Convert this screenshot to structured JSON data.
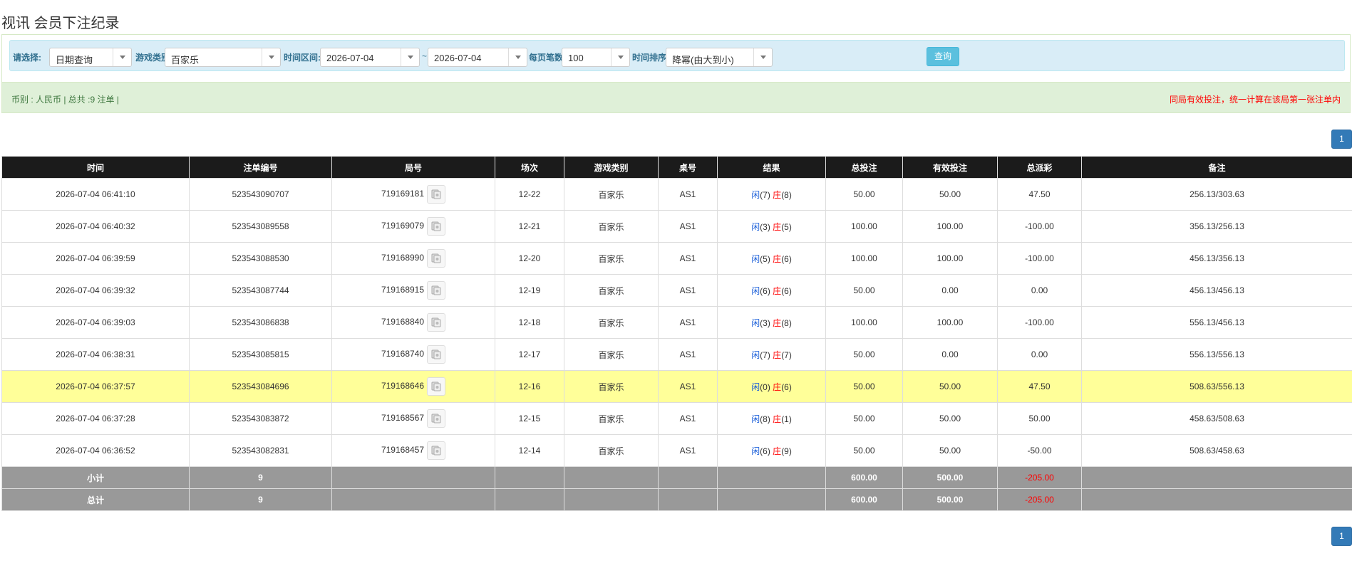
{
  "page": {
    "title": "视讯 会员下注纪录"
  },
  "filters": {
    "select_label": "请选择:",
    "select_value": "日期查询",
    "game_type_label": "游戏类别",
    "game_type_value": "百家乐",
    "time_range_label": "时间区间:",
    "date_from": "2026-07-04",
    "tilde": "~",
    "date_to": "2026-07-04",
    "page_size_label": "每页笔数:",
    "page_size_value": "100",
    "sort_label": "时间排序:",
    "sort_value": "降幂(由大到小)",
    "query_button": "查询"
  },
  "summary": {
    "left": "币别 : 人民币 | 总共 :9 注单 |",
    "right": "同局有效投注，统一计算在该局第一张注单内"
  },
  "pagination": {
    "current_page": "1"
  },
  "table": {
    "columns": [
      "时间",
      "注单编号",
      "局号",
      "场次",
      "游戏类别",
      "桌号",
      "结果",
      "总投注",
      "有效投注",
      "总派彩",
      "备注"
    ],
    "rows": [
      {
        "time": "2026-07-04 06:41:10",
        "bet_id": "523543090707",
        "round": "719169181",
        "shoe": "12-22",
        "game": "百家乐",
        "table": "AS1",
        "player_label": "闲",
        "player_score": "(7)",
        "banker_label": "庄",
        "banker_score": "(8)",
        "total_bet": "50.00",
        "valid_bet": "50.00",
        "payout": "47.50",
        "payout_negative": false,
        "note": "256.13/303.63",
        "highlight": false
      },
      {
        "time": "2026-07-04 06:40:32",
        "bet_id": "523543089558",
        "round": "719169079",
        "shoe": "12-21",
        "game": "百家乐",
        "table": "AS1",
        "player_label": "闲",
        "player_score": "(3)",
        "banker_label": "庄",
        "banker_score": "(5)",
        "total_bet": "100.00",
        "valid_bet": "100.00",
        "payout": "-100.00",
        "payout_negative": true,
        "note": "356.13/256.13",
        "highlight": false
      },
      {
        "time": "2026-07-04 06:39:59",
        "bet_id": "523543088530",
        "round": "719168990",
        "shoe": "12-20",
        "game": "百家乐",
        "table": "AS1",
        "player_label": "闲",
        "player_score": "(5)",
        "banker_label": "庄",
        "banker_score": "(6)",
        "total_bet": "100.00",
        "valid_bet": "100.00",
        "payout": "-100.00",
        "payout_negative": true,
        "note": "456.13/356.13",
        "highlight": false
      },
      {
        "time": "2026-07-04 06:39:32",
        "bet_id": "523543087744",
        "round": "719168915",
        "shoe": "12-19",
        "game": "百家乐",
        "table": "AS1",
        "player_label": "闲",
        "player_score": "(6)",
        "banker_label": "庄",
        "banker_score": "(6)",
        "total_bet": "50.00",
        "valid_bet": "0.00",
        "payout": "0.00",
        "payout_negative": false,
        "note": "456.13/456.13",
        "highlight": false
      },
      {
        "time": "2026-07-04 06:39:03",
        "bet_id": "523543086838",
        "round": "719168840",
        "shoe": "12-18",
        "game": "百家乐",
        "table": "AS1",
        "player_label": "闲",
        "player_score": "(3)",
        "banker_label": "庄",
        "banker_score": "(8)",
        "total_bet": "100.00",
        "valid_bet": "100.00",
        "payout": "-100.00",
        "payout_negative": true,
        "note": "556.13/456.13",
        "highlight": false
      },
      {
        "time": "2026-07-04 06:38:31",
        "bet_id": "523543085815",
        "round": "719168740",
        "shoe": "12-17",
        "game": "百家乐",
        "table": "AS1",
        "player_label": "闲",
        "player_score": "(7)",
        "banker_label": "庄",
        "banker_score": "(7)",
        "total_bet": "50.00",
        "valid_bet": "0.00",
        "payout": "0.00",
        "payout_negative": false,
        "note": "556.13/556.13",
        "highlight": false
      },
      {
        "time": "2026-07-04 06:37:57",
        "bet_id": "523543084696",
        "round": "719168646",
        "shoe": "12-16",
        "game": "百家乐",
        "table": "AS1",
        "player_label": "闲",
        "player_score": "(0)",
        "banker_label": "庄",
        "banker_score": "(6)",
        "total_bet": "50.00",
        "valid_bet": "50.00",
        "payout": "47.50",
        "payout_negative": false,
        "note": "508.63/556.13",
        "highlight": true
      },
      {
        "time": "2026-07-04 06:37:28",
        "bet_id": "523543083872",
        "round": "719168567",
        "shoe": "12-15",
        "game": "百家乐",
        "table": "AS1",
        "player_label": "闲",
        "player_score": "(8)",
        "banker_label": "庄",
        "banker_score": "(1)",
        "total_bet": "50.00",
        "valid_bet": "50.00",
        "payout": "50.00",
        "payout_negative": false,
        "note": "458.63/508.63",
        "highlight": false
      },
      {
        "time": "2026-07-04 06:36:52",
        "bet_id": "523543082831",
        "round": "719168457",
        "shoe": "12-14",
        "game": "百家乐",
        "table": "AS1",
        "player_label": "闲",
        "player_score": "(6)",
        "banker_label": "庄",
        "banker_score": "(9)",
        "total_bet": "50.00",
        "valid_bet": "50.00",
        "payout": "-50.00",
        "payout_negative": true,
        "note": "508.63/458.63",
        "highlight": false
      }
    ],
    "totals": [
      {
        "label": "小计",
        "count": "9",
        "total_bet": "600.00",
        "valid_bet": "500.00",
        "payout": "-205.00"
      },
      {
        "label": "总计",
        "count": "9",
        "total_bet": "600.00",
        "valid_bet": "500.00",
        "payout": "-205.00"
      }
    ]
  },
  "colors": {
    "header_bg": "#1b1b1b",
    "highlight_row": "#ffff99",
    "total_row": "#999999",
    "negative": "#ff0000",
    "bet_amount": "#1b5fd9",
    "query_button": "#5bc0de",
    "pager": "#337ab7"
  },
  "icons": {
    "round_detail": "card-table-icon",
    "select_caret": "chevron-down-icon"
  }
}
